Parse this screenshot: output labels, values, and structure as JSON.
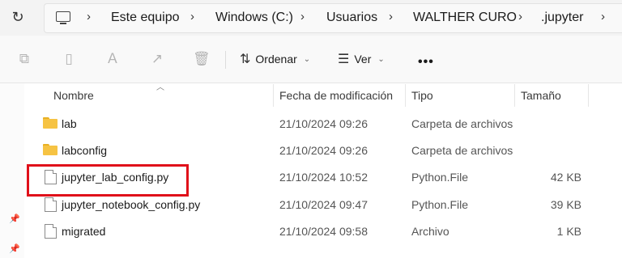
{
  "breadcrumb": [
    "Este equipo",
    "Windows (C:)",
    "Usuarios",
    "WALTHER CURO",
    ".jupyter"
  ],
  "toolbar": {
    "sort_label": "Ordenar",
    "view_label": "Ver"
  },
  "columns": {
    "name": "Nombre",
    "modified": "Fecha de modificación",
    "type": "Tipo",
    "size": "Tamaño"
  },
  "files": [
    {
      "name": "lab",
      "modified": "21/10/2024 09:26",
      "type": "Carpeta de archivos",
      "size": "",
      "icon": "folder-icon"
    },
    {
      "name": "labconfig",
      "modified": "21/10/2024 09:26",
      "type": "Carpeta de archivos",
      "size": "",
      "icon": "folder-icon"
    },
    {
      "name": "jupyter_lab_config.py",
      "modified": "21/10/2024 10:52",
      "type": "Python.File",
      "size": "42 KB",
      "icon": "file-icon"
    },
    {
      "name": "jupyter_notebook_config.py",
      "modified": "21/10/2024 09:47",
      "type": "Python.File",
      "size": "39 KB",
      "icon": "file-icon"
    },
    {
      "name": "migrated",
      "modified": "21/10/2024 09:58",
      "type": "Archivo",
      "size": "1 KB",
      "icon": "file-icon"
    }
  ],
  "colors": {
    "highlight": "#e0101a",
    "folder": "#f6c343"
  }
}
